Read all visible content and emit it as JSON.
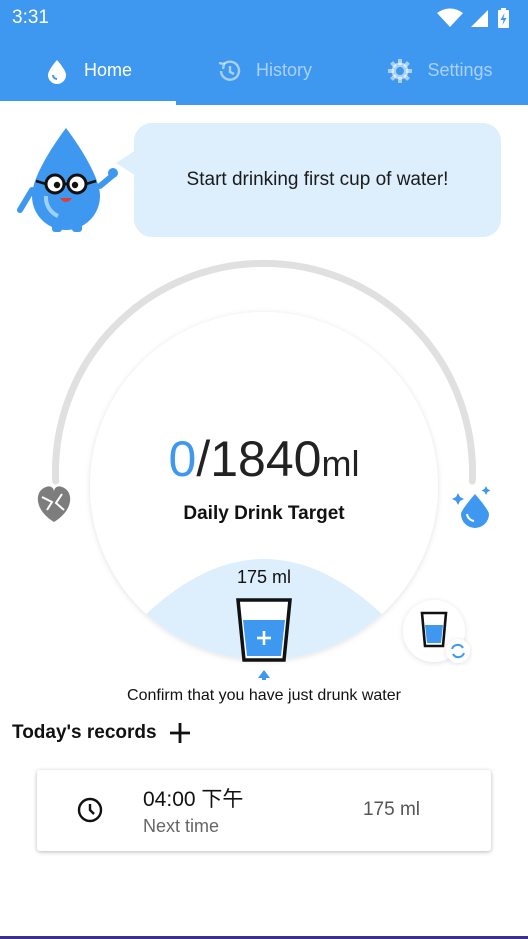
{
  "status_bar": {
    "time": "3:31",
    "icons": [
      "wifi-icon",
      "signal-icon",
      "battery-charging-icon"
    ]
  },
  "tabs": [
    {
      "label": "Home",
      "icon": "water-drop-icon",
      "active": true
    },
    {
      "label": "History",
      "icon": "history-icon",
      "active": false
    },
    {
      "label": "Settings",
      "icon": "gear-icon",
      "active": false
    }
  ],
  "mascot": {
    "message": "Start drinking first cup of water!"
  },
  "progress": {
    "current": "0",
    "separator": "/",
    "target": "1840",
    "unit": "ml",
    "label": "Daily Drink Target",
    "fraction": 0
  },
  "cup": {
    "amount": "175 ml",
    "confirm_text": "Confirm that you have just drunk water"
  },
  "records": {
    "title": "Today's records",
    "items": [
      {
        "time": "04:00 下午",
        "note": "Next time",
        "amount": "175 ml"
      }
    ]
  },
  "colors": {
    "primary": "#3f98ef",
    "light": "#ddeefc",
    "arc_track": "#e0e0e0"
  }
}
